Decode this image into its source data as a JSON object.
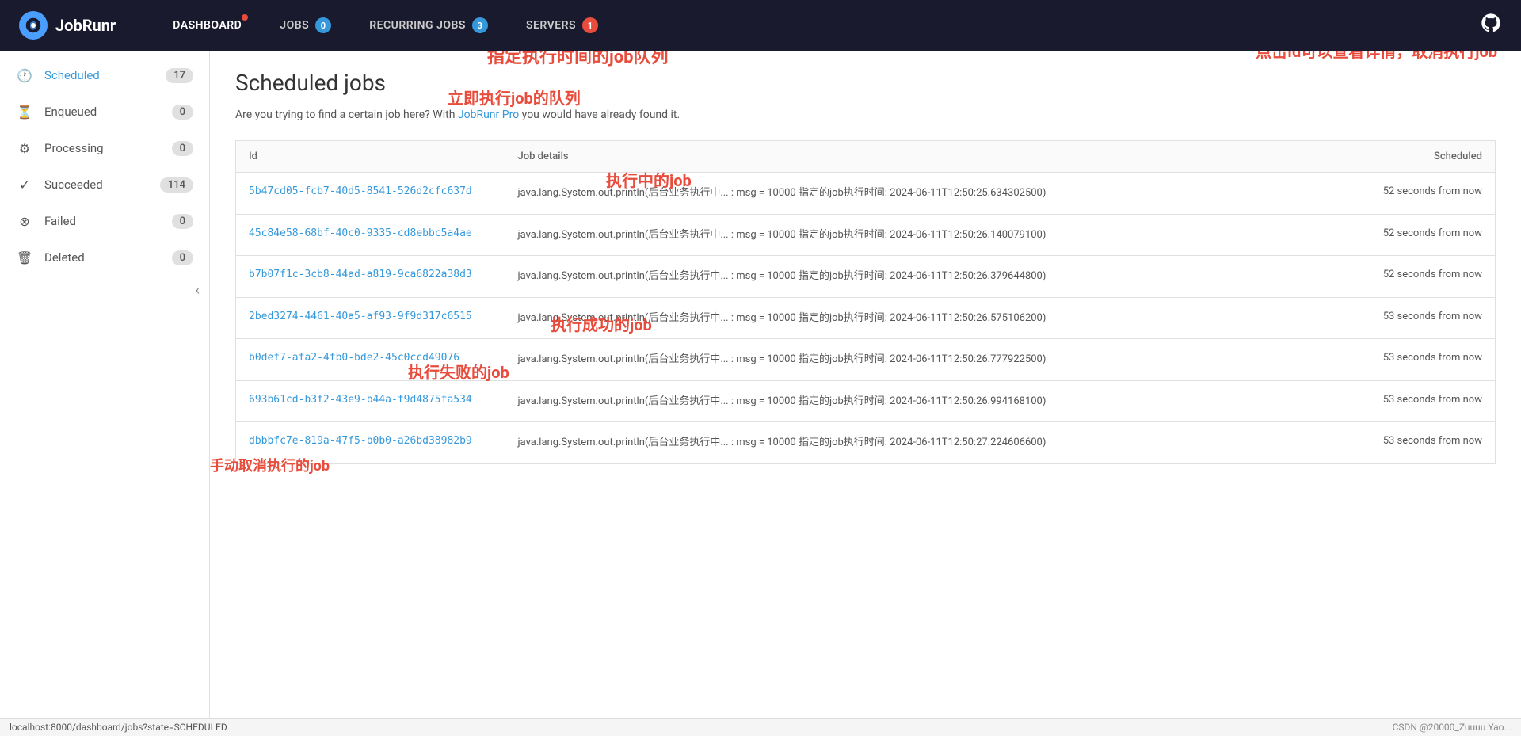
{
  "header": {
    "logo_text": "JobRunr",
    "nav_items": [
      {
        "id": "dashboard",
        "label": "DASHBOARD",
        "badge": null,
        "dot": true
      },
      {
        "id": "jobs",
        "label": "JOBS",
        "badge": "0",
        "badge_color": "blue",
        "dot": false
      },
      {
        "id": "recurring-jobs",
        "label": "RECURRING JOBS",
        "badge": "3",
        "badge_color": "blue",
        "dot": false
      },
      {
        "id": "servers",
        "label": "SERVERS",
        "badge": "1",
        "badge_color": "red",
        "dot": false
      }
    ]
  },
  "sidebar": {
    "items": [
      {
        "id": "scheduled",
        "label": "Scheduled",
        "count": "17",
        "icon": "🕐",
        "active": true
      },
      {
        "id": "enqueued",
        "label": "Enqueued",
        "count": "0",
        "icon": "⏳",
        "active": false
      },
      {
        "id": "processing",
        "label": "Processing",
        "count": "0",
        "icon": "⚙️",
        "active": false
      },
      {
        "id": "succeeded",
        "label": "Succeeded",
        "count": "114",
        "icon": "✓",
        "active": false
      },
      {
        "id": "failed",
        "label": "Failed",
        "count": "0",
        "icon": "⊗",
        "active": false
      },
      {
        "id": "deleted",
        "label": "Deleted",
        "count": "0",
        "icon": "🗑",
        "active": false
      }
    ]
  },
  "page": {
    "title": "Scheduled jobs",
    "pro_banner": "Are you trying to find a certain job here? With ",
    "pro_link_text": "JobRunr Pro",
    "pro_banner_end": " you would have already found it.",
    "table_headers": {
      "id": "Id",
      "job_details": "Job details",
      "scheduled": "Scheduled"
    }
  },
  "jobs": [
    {
      "id": "5b47cd05-fcb7-40d5-8541-526d2cfc637d",
      "details": "java.lang.System.out.println(后台业务执行中... : msg = 10000 指定的job执行时间: 2024-06-11T12:50:25.634302500)",
      "scheduled": "52 seconds from now"
    },
    {
      "id": "45c84e58-68bf-40c0-9335-cd8ebbc5a4ae",
      "details": "java.lang.System.out.println(后台业务执行中... : msg = 10000 指定的job执行时间: 2024-06-11T12:50:26.140079100)",
      "scheduled": "52 seconds from now"
    },
    {
      "id": "b7b07f1c-3cb8-44ad-a819-9ca6822a38d3",
      "details": "java.lang.System.out.println(后台业务执行中... : msg = 10000 指定的job执行时间: 2024-06-11T12:50:26.379644800)",
      "scheduled": "52 seconds from now"
    },
    {
      "id": "2bed3274-4461-40a5-af93-9f9d317c6515",
      "details": "java.lang.System.out.println(后台业务执行中... : msg = 10000 指定的job执行时间: 2024-06-11T12:50:26.575106200)",
      "scheduled": "53 seconds from now"
    },
    {
      "id": "b0def7-afa2-4fb0-bde2-45c0ccd49076",
      "details": "java.lang.System.out.println(后台业务执行中... : msg = 10000 指定的job执行时间: 2024-06-11T12:50:26.777922500)",
      "scheduled": "53 seconds from now"
    },
    {
      "id": "693b61cd-b3f2-43e9-b44a-f9d4875fa534",
      "details": "java.lang.System.out.println(后台业务执行中... : msg = 10000 指定的job执行时间: 2024-06-11T12:50:26.994168100)",
      "scheduled": "53 seconds from now"
    },
    {
      "id": "dbbbfc7e-819a-47f5-b0b0-a26bd38982b9",
      "details": "java.lang.System.out.println(后台业务执行中... : msg = 10000 指定的job执行时间: 2024-06-11T12:50:27.224606600)",
      "scheduled": "53 seconds from now"
    }
  ],
  "annotations": {
    "queue_label": "指定执行时间的job队列",
    "immediate_label": "立即执行job的队列",
    "processing_label": "执行中的job",
    "success_label": "执行成功的job",
    "fail_label": "执行失败的job",
    "cancel_label": "手动取消执行的job",
    "click_id_label": "点击Id可以查看详情，取消执行job"
  },
  "statusbar": {
    "url": "localhost:8000/dashboard/jobs?state=SCHEDULED",
    "watermark": "CSDN @20000_Zuuuu Yao..."
  }
}
